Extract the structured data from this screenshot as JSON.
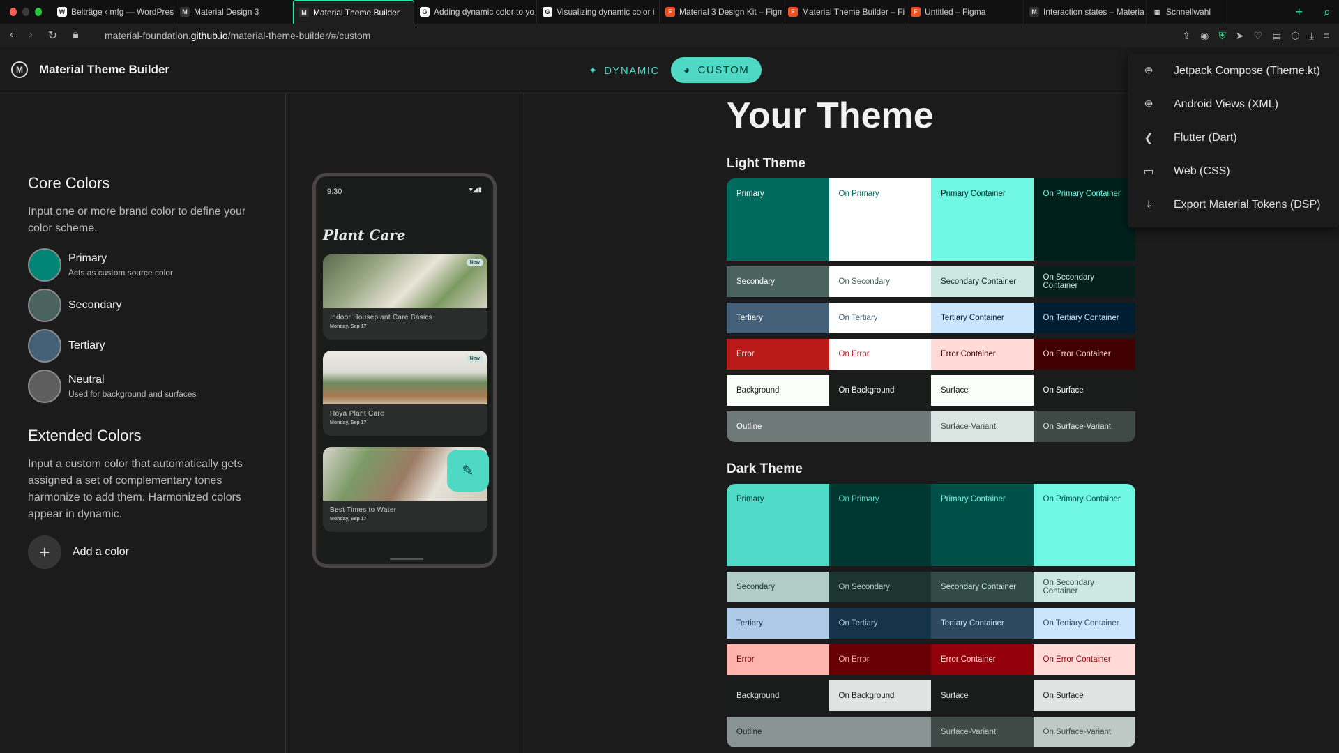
{
  "browser": {
    "tabs": [
      {
        "label": "Beiträge ‹ mfg — WordPres",
        "fav": "W",
        "favbg": "#fff",
        "favfg": "#222",
        "active": false
      },
      {
        "label": "Material Design 3",
        "fav": "M",
        "favbg": "#333",
        "favfg": "#ddd",
        "active": false
      },
      {
        "label": "Material Theme Builder",
        "fav": "M",
        "favbg": "#333",
        "favfg": "#ddd",
        "active": true
      },
      {
        "label": "Adding dynamic color to yo",
        "fav": "G",
        "favbg": "#fff",
        "favfg": "#222",
        "active": false
      },
      {
        "label": "Visualizing dynamic color i",
        "fav": "G",
        "favbg": "#fff",
        "favfg": "#222",
        "active": false
      },
      {
        "label": "Material 3 Design Kit – Figm",
        "fav": "F",
        "favbg": "#f24e1e",
        "favfg": "#fff",
        "active": false
      },
      {
        "label": "Material Theme Builder – Fi",
        "fav": "F",
        "favbg": "#f24e1e",
        "favfg": "#fff",
        "active": false
      },
      {
        "label": "Untitled – Figma",
        "fav": "F",
        "favbg": "#f24e1e",
        "favfg": "#fff",
        "active": false
      },
      {
        "label": "Interaction states – Materia",
        "fav": "M",
        "favbg": "#333",
        "favfg": "#ddd",
        "active": false
      },
      {
        "label": "Schnellwahl",
        "fav": "▦",
        "favbg": "#111",
        "favfg": "#fff",
        "active": false
      }
    ],
    "url_prefix": "material-foundation.",
    "url_host": "github.io",
    "url_path": "/material-theme-builder/#/custom"
  },
  "header": {
    "title": "Material Theme Builder",
    "dynamic_label": "DYNAMIC",
    "custom_label": "CUSTOM"
  },
  "left": {
    "core_title": "Core Colors",
    "core_desc": "Input one or more brand color to define your color scheme.",
    "swatches": [
      {
        "label": "Primary",
        "sub": "Acts as custom source color",
        "color": "#008577"
      },
      {
        "label": "Secondary",
        "sub": "",
        "color": "#4a635e"
      },
      {
        "label": "Tertiary",
        "sub": "",
        "color": "#456179"
      },
      {
        "label": "Neutral",
        "sub": "Used for background and surfaces",
        "color": "#5e5e5e"
      }
    ],
    "extended_title": "Extended Colors",
    "extended_desc": "Input a custom color that automatically gets assigned a set of complementary tones harmonize to add them. Harmonized colors appear in dynamic.",
    "add_color": "Add a color"
  },
  "phone": {
    "time": "9:30",
    "status": "▾◢▮",
    "title": "Plant Care",
    "cards": [
      {
        "title": "Indoor Houseplant Care Basics",
        "date": "Monday, Sep 17",
        "badge": "New"
      },
      {
        "title": "Hoya Plant Care",
        "date": "Monday, Sep 17",
        "badge": "New"
      },
      {
        "title": "Best Times to Water",
        "date": "Monday, Sep 17",
        "badge": ""
      }
    ]
  },
  "theme": {
    "title": "Your Theme",
    "light_title": "Light Theme",
    "dark_title": "Dark Theme",
    "light": [
      [
        [
          "Primary",
          "#006a5f",
          "#ffffff"
        ],
        [
          "On Primary",
          "#ffffff",
          "#006a5f"
        ],
        [
          "Primary Container",
          "#6ff7e3",
          "#00201c"
        ],
        [
          "On Primary Container",
          "#00201c",
          "#6ff7e3"
        ]
      ],
      [
        [
          "Secondary",
          "#4a635e",
          "#ffffff"
        ],
        [
          "On Secondary",
          "#ffffff",
          "#4a635e"
        ],
        [
          "Secondary Container",
          "#cce8e1",
          "#05201b"
        ],
        [
          "On Secondary Container",
          "#05201b",
          "#cce8e1"
        ]
      ],
      [
        [
          "Tertiary",
          "#456179",
          "#ffffff"
        ],
        [
          "On Tertiary",
          "#ffffff",
          "#456179"
        ],
        [
          "Tertiary Container",
          "#cce5ff",
          "#001e31"
        ],
        [
          "On Tertiary Container",
          "#001e31",
          "#cce5ff"
        ]
      ],
      [
        [
          "Error",
          "#ba1a1a",
          "#ffffff"
        ],
        [
          "On Error",
          "#ffffff",
          "#ba1a1a"
        ],
        [
          "Error Container",
          "#ffdad6",
          "#410002"
        ],
        [
          "On Error Container",
          "#410002",
          "#ffdad6"
        ]
      ],
      [
        [
          "Background",
          "#fafdfa",
          "#191c1b"
        ],
        [
          "On Background",
          "#191c1b",
          "#fafdfa"
        ],
        [
          "Surface",
          "#fafdfa",
          "#191c1b"
        ],
        [
          "On Surface",
          "#191c1b",
          "#fafdfa"
        ]
      ],
      [
        [
          "Outline",
          "#6f7977",
          "#ffffff",
          true
        ],
        [
          "Surface-Variant",
          "#dae5e1",
          "#3f4946"
        ],
        [
          "On Surface-Variant",
          "#3f4946",
          "#dae5e1"
        ]
      ]
    ],
    "dark": [
      [
        [
          "Primary",
          "#4fdbc7",
          "#003731"
        ],
        [
          "On Primary",
          "#003731",
          "#4fdbc7"
        ],
        [
          "Primary Container",
          "#005048",
          "#6ff7e3"
        ],
        [
          "On Primary Container",
          "#6ff7e3",
          "#005048"
        ]
      ],
      [
        [
          "Secondary",
          "#b1ccc5",
          "#1c3531"
        ],
        [
          "On Secondary",
          "#1c3531",
          "#b1ccc5"
        ],
        [
          "Secondary Container",
          "#334b47",
          "#cce8e1"
        ],
        [
          "On Secondary Container",
          "#cce8e1",
          "#334b47"
        ]
      ],
      [
        [
          "Tertiary",
          "#adcae6",
          "#153349"
        ],
        [
          "On Tertiary",
          "#153349",
          "#adcae6"
        ],
        [
          "Tertiary Container",
          "#2d4960",
          "#cce5ff"
        ],
        [
          "On Tertiary Container",
          "#cce5ff",
          "#2d4960"
        ]
      ],
      [
        [
          "Error",
          "#ffb4ab",
          "#690005"
        ],
        [
          "On Error",
          "#690005",
          "#ffb4ab"
        ],
        [
          "Error Container",
          "#93000a",
          "#ffdad6"
        ],
        [
          "On Error Container",
          "#ffdad6",
          "#93000a"
        ]
      ],
      [
        [
          "Background",
          "#191c1b",
          "#e0e3e1"
        ],
        [
          "On Background",
          "#e0e3e1",
          "#191c1b"
        ],
        [
          "Surface",
          "#191c1b",
          "#e0e3e1"
        ],
        [
          "On Surface",
          "#e0e3e1",
          "#191c1b"
        ]
      ],
      [
        [
          "Outline",
          "#899391",
          "#191c1b",
          true
        ],
        [
          "Surface-Variant",
          "#3f4946",
          "#bec9c5"
        ],
        [
          "On Surface-Variant",
          "#bec9c5",
          "#3f4946"
        ]
      ]
    ]
  },
  "export_menu": [
    {
      "label": "Jetpack Compose (Theme.kt)",
      "icon": "android-icon"
    },
    {
      "label": "Android Views (XML)",
      "icon": "android-icon"
    },
    {
      "label": "Flutter (Dart)",
      "icon": "flutter-icon"
    },
    {
      "label": "Web (CSS)",
      "icon": "web-icon"
    },
    {
      "label": "Export Material Tokens (DSP)",
      "icon": "download-icon"
    }
  ]
}
